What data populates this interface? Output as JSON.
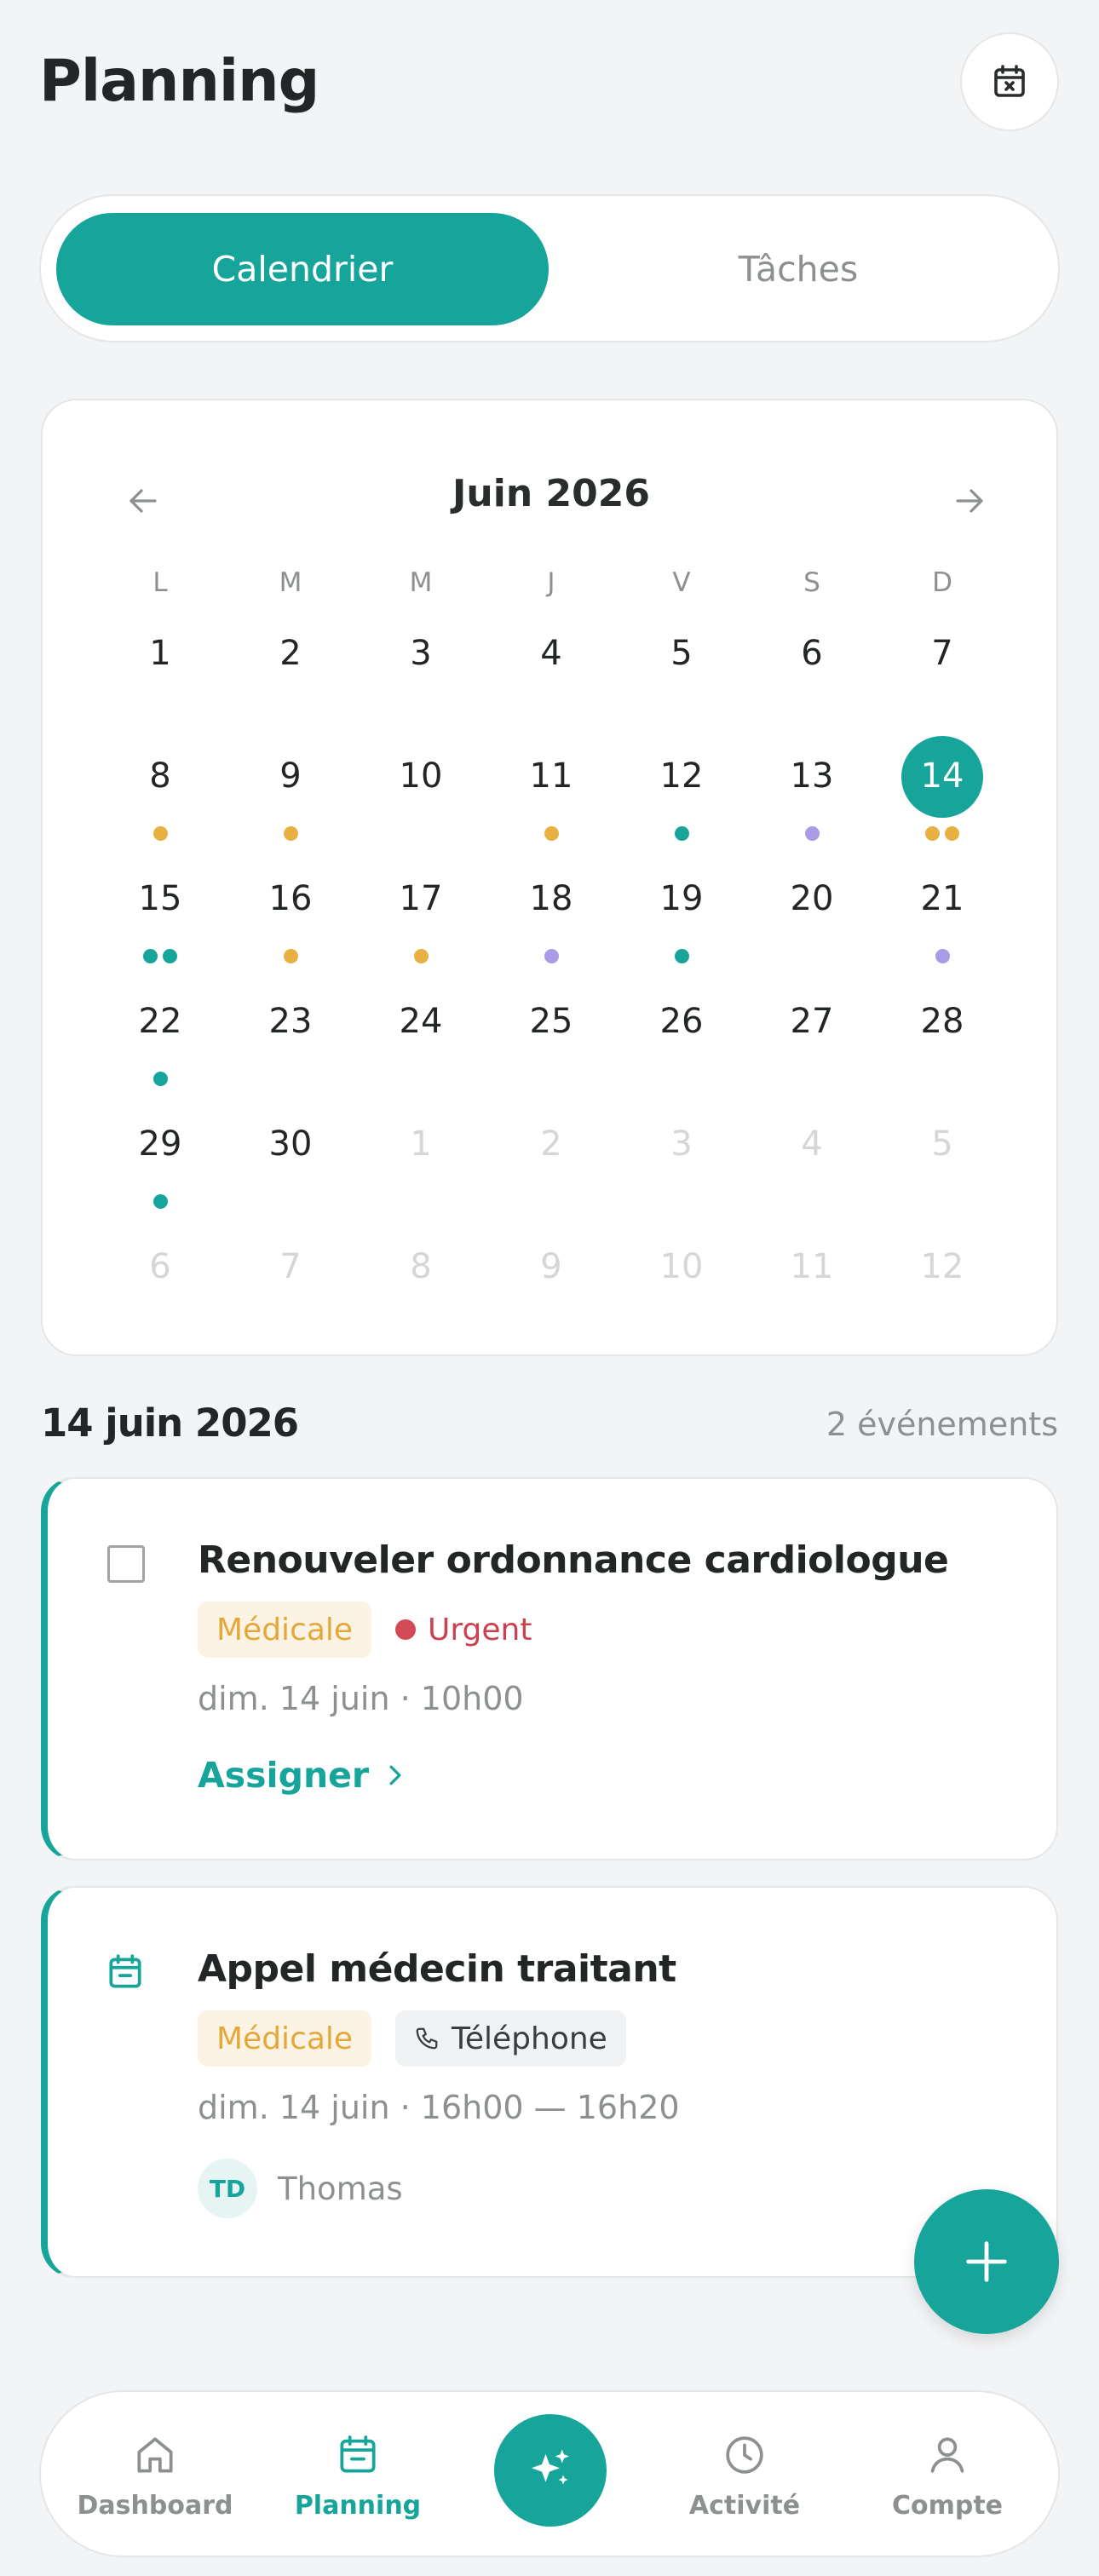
{
  "header": {
    "title": "Planning"
  },
  "segment": {
    "calendar": "Calendrier",
    "tasks": "Tâches"
  },
  "calendar": {
    "month": "Juin 2026",
    "weekdays": [
      "L",
      "M",
      "M",
      "J",
      "V",
      "S",
      "D"
    ],
    "weeks": [
      [
        "1",
        "2",
        "3",
        "4",
        "5",
        "6",
        "7"
      ],
      [
        "8",
        "9",
        "10",
        "11",
        "12",
        "13",
        "14"
      ],
      [
        "15",
        "16",
        "17",
        "18",
        "19",
        "20",
        "21"
      ],
      [
        "22",
        "23",
        "24",
        "25",
        "26",
        "27",
        "28"
      ],
      [
        "29",
        "30",
        "1",
        "2",
        "3",
        "4",
        "5"
      ],
      [
        "6",
        "7",
        "8",
        "9",
        "10",
        "11",
        "12"
      ]
    ],
    "selected_day": "14",
    "colors": {
      "medical": "#e8b040",
      "teal": "#16a49b",
      "purple": "#a99be6",
      "muted": "#d4d6d7"
    }
  },
  "selected_date": {
    "title": "14 juin 2026",
    "count": "2 événements"
  },
  "events": [
    {
      "title": "Renouveler ordonnance cardiologue",
      "category": "Médicale",
      "priority": "Urgent",
      "time": "dim. 14 juin · 10h00",
      "action": "Assigner"
    },
    {
      "title": "Appel médecin traitant",
      "category": "Médicale",
      "channel": "Téléphone",
      "time": "dim. 14 juin · 16h00 — 16h20",
      "assignee_initials": "TD",
      "assignee_name": "Thomas"
    }
  ],
  "nav": {
    "dashboard": "Dashboard",
    "planning": "Planning",
    "activity": "Activité",
    "account": "Compte"
  }
}
